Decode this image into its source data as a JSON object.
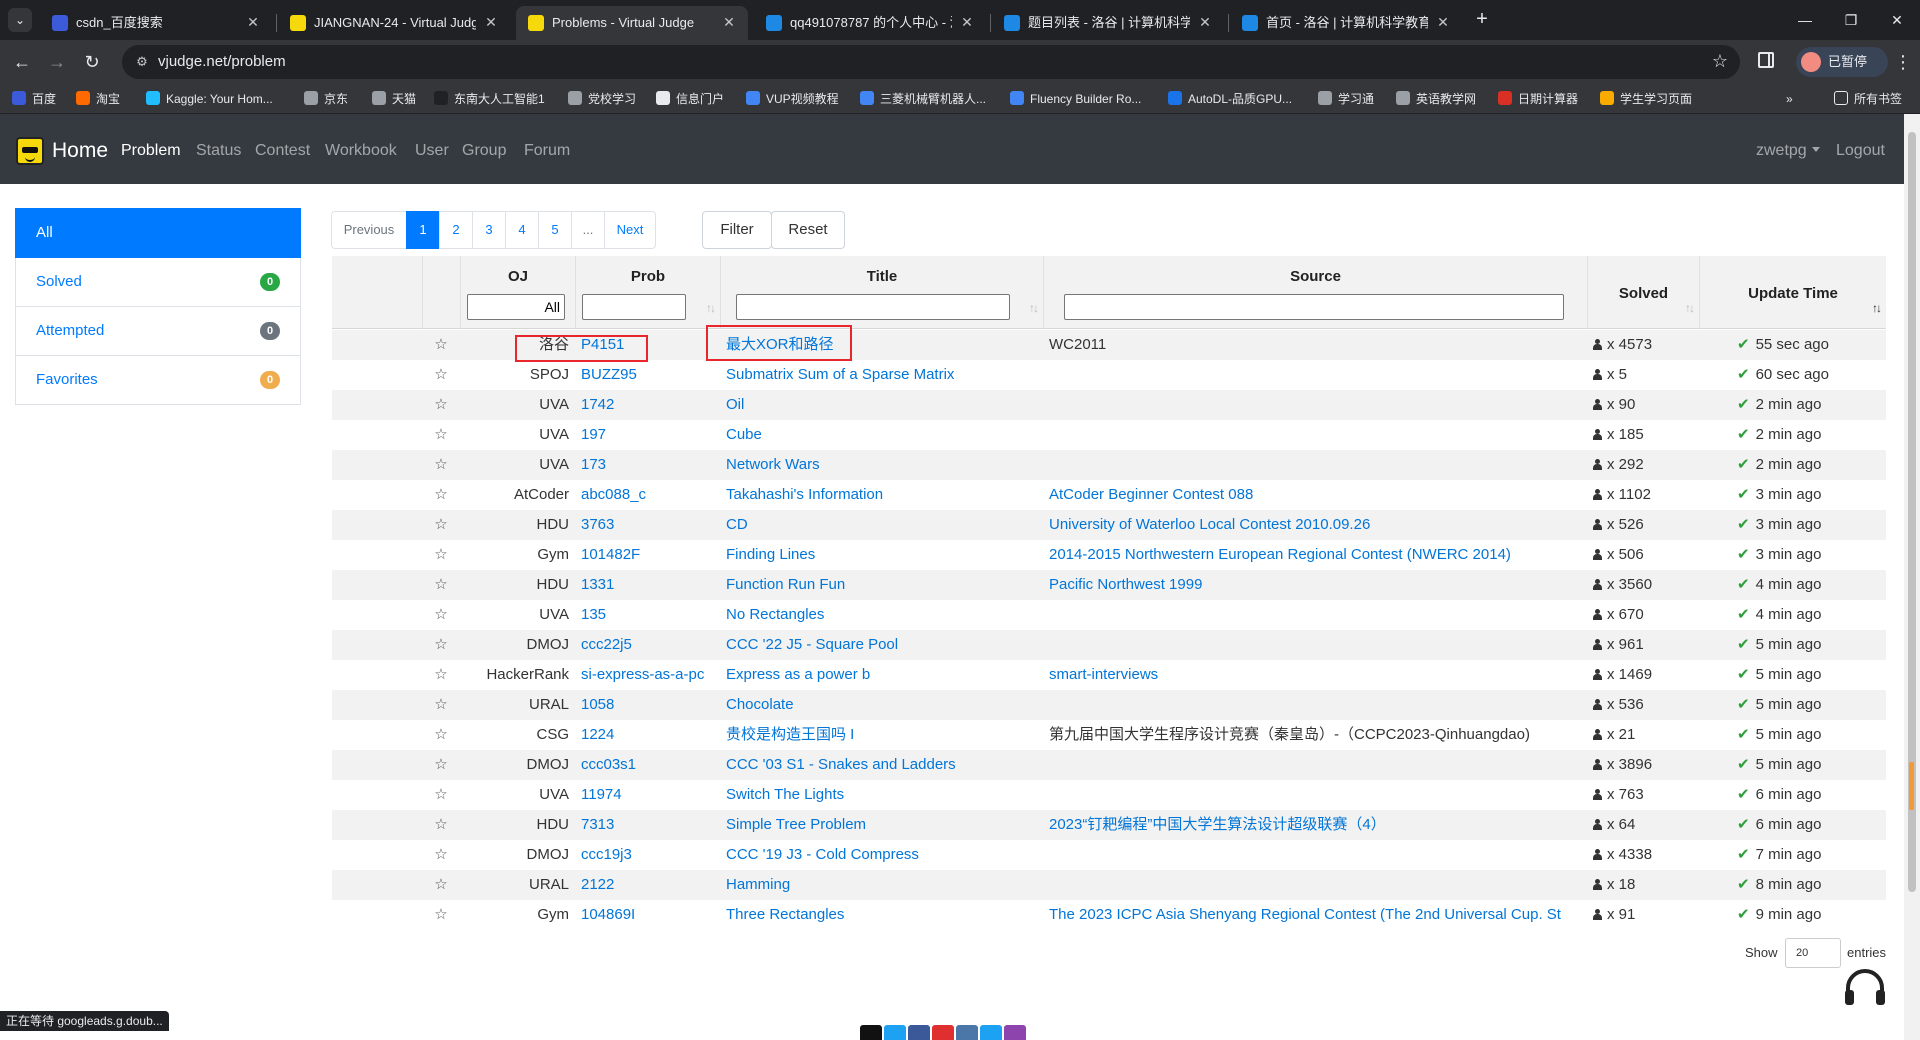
{
  "browser": {
    "tabs": [
      {
        "title": "csdn_百度搜索",
        "active": false,
        "color": "#3b5bdb"
      },
      {
        "title": "JIANGNAN-24 - Virtual Judge",
        "active": false,
        "color": "#f5d90a"
      },
      {
        "title": "Problems - Virtual Judge",
        "active": true,
        "color": "#f5d90a"
      },
      {
        "title": "qq491078787 的个人中心 - 洛谷",
        "active": false,
        "color": "#1e88e5"
      },
      {
        "title": "题目列表 - 洛谷 | 计算机科学教育新生态",
        "active": false,
        "color": "#1e88e5"
      },
      {
        "title": "首页 - 洛谷 | 计算机科学教育新生态",
        "active": false,
        "color": "#1e88e5"
      }
    ],
    "url": "vjudge.net/problem",
    "profile_label": "已暂停",
    "bookmarks": [
      {
        "label": "百度",
        "color": "#3b5bdb"
      },
      {
        "label": "淘宝",
        "color": "#ff6a00"
      },
      {
        "label": "Kaggle: Your Hom...",
        "color": "#20beff"
      },
      {
        "label": "京东",
        "color": "#9aa0a6"
      },
      {
        "label": "天猫",
        "color": "#9aa0a6"
      },
      {
        "label": "东南大人工智能1",
        "color": "#202124"
      },
      {
        "label": "党校学习",
        "color": "#9aa0a6"
      },
      {
        "label": "信息门户",
        "color": "#e8eaed"
      },
      {
        "label": "VUP视频教程",
        "color": "#4285f4"
      },
      {
        "label": "三菱机械臂机器人...",
        "color": "#4285f4"
      },
      {
        "label": "Fluency Builder Ro...",
        "color": "#4285f4"
      },
      {
        "label": "AutoDL-品质GPU...",
        "color": "#1a73e8"
      },
      {
        "label": "学习通",
        "color": "#9aa0a6"
      },
      {
        "label": "英语教学网",
        "color": "#9aa0a6"
      },
      {
        "label": "日期计算器",
        "color": "#d93025"
      },
      {
        "label": "学生学习页面",
        "color": "#f9ab00"
      }
    ],
    "bookmarks_more": "»",
    "all_bookmarks": "所有书签",
    "status_text": "正在等待 googleads.g.doub..."
  },
  "nav": {
    "brand": "Home",
    "links": [
      "Problem",
      "Status",
      "Contest",
      "Workbook",
      "User",
      "Group",
      "Forum"
    ],
    "active_link": "Problem",
    "user": "zwetpg",
    "logout": "Logout"
  },
  "sidebar": {
    "items": [
      {
        "label": "All",
        "badge": "",
        "active": true
      },
      {
        "label": "Solved",
        "badge": "0",
        "badge_color": "#28a745"
      },
      {
        "label": "Attempted",
        "badge": "0",
        "badge_color": "#6c757d"
      },
      {
        "label": "Favorites",
        "badge": "0",
        "badge_color": "#f0ad4e"
      }
    ]
  },
  "pagination": {
    "previous": "Previous",
    "pages": [
      "1",
      "2",
      "3",
      "4",
      "5",
      "..."
    ],
    "current": "1",
    "next": "Next"
  },
  "buttons": {
    "filter": "Filter",
    "reset": "Reset"
  },
  "table": {
    "headers": {
      "oj": "OJ",
      "prob": "Prob",
      "title": "Title",
      "source": "Source",
      "solved": "Solved",
      "update": "Update Time"
    },
    "filters": {
      "oj_value": "All",
      "prob_value": "",
      "title_value": "",
      "source_value": ""
    },
    "rows": [
      {
        "oj": "洛谷",
        "prob": "P4151",
        "title": "最大XOR和路径",
        "source": "WC2011",
        "source_link": false,
        "solved": "x 4573",
        "update": "55 sec ago"
      },
      {
        "oj": "SPOJ",
        "prob": "BUZZ95",
        "title": "Submatrix Sum of a Sparse Matrix",
        "source": "",
        "source_link": false,
        "solved": "x 5",
        "update": "60 sec ago"
      },
      {
        "oj": "UVA",
        "prob": "1742",
        "title": "Oil",
        "source": "",
        "source_link": false,
        "solved": "x 90",
        "update": "2 min ago"
      },
      {
        "oj": "UVA",
        "prob": "197",
        "title": "Cube",
        "source": "",
        "source_link": false,
        "solved": "x 185",
        "update": "2 min ago"
      },
      {
        "oj": "UVA",
        "prob": "173",
        "title": "Network Wars",
        "source": "",
        "source_link": false,
        "solved": "x 292",
        "update": "2 min ago"
      },
      {
        "oj": "AtCoder",
        "prob": "abc088_c",
        "title": "Takahashi's Information",
        "source": "AtCoder Beginner Contest 088",
        "source_link": true,
        "solved": "x 1102",
        "update": "3 min ago"
      },
      {
        "oj": "HDU",
        "prob": "3763",
        "title": "CD",
        "source": "University of Waterloo Local Contest 2010.09.26",
        "source_link": true,
        "solved": "x 526",
        "update": "3 min ago"
      },
      {
        "oj": "Gym",
        "prob": "101482F",
        "title": "Finding Lines",
        "source": "2014-2015 Northwestern European Regional Contest (NWERC 2014)",
        "source_link": true,
        "solved": "x 506",
        "update": "3 min ago"
      },
      {
        "oj": "HDU",
        "prob": "1331",
        "title": "Function Run Fun",
        "source": "Pacific Northwest 1999",
        "source_link": true,
        "solved": "x 3560",
        "update": "4 min ago"
      },
      {
        "oj": "UVA",
        "prob": "135",
        "title": "No Rectangles",
        "source": "",
        "source_link": false,
        "solved": "x 670",
        "update": "4 min ago"
      },
      {
        "oj": "DMOJ",
        "prob": "ccc22j5",
        "title": "CCC '22 J5 - Square Pool",
        "source": "",
        "source_link": false,
        "solved": "x 961",
        "update": "5 min ago"
      },
      {
        "oj": "HackerRank",
        "prob": "si-express-as-a-pc",
        "title": "Express as a power b",
        "source": "smart-interviews",
        "source_link": true,
        "solved": "x 1469",
        "update": "5 min ago"
      },
      {
        "oj": "URAL",
        "prob": "1058",
        "title": "Chocolate",
        "source": "",
        "source_link": false,
        "solved": "x 536",
        "update": "5 min ago"
      },
      {
        "oj": "CSG",
        "prob": "1224",
        "title": "贵校是构造王国吗 I",
        "source": "第九届中国大学生程序设计竞赛（秦皇岛）-（CCPC2023-Qinhuangdao)",
        "source_link": false,
        "solved": "x 21",
        "update": "5 min ago"
      },
      {
        "oj": "DMOJ",
        "prob": "ccc03s1",
        "title": "CCC '03 S1 - Snakes and Ladders",
        "source": "",
        "source_link": false,
        "solved": "x 3896",
        "update": "5 min ago"
      },
      {
        "oj": "UVA",
        "prob": "11974",
        "title": "Switch The Lights",
        "source": "",
        "source_link": false,
        "solved": "x 763",
        "update": "6 min ago"
      },
      {
        "oj": "HDU",
        "prob": "7313",
        "title": "Simple Tree Problem",
        "source": "2023“钉耙编程”中国大学生算法设计超级联赛（4）",
        "source_link": true,
        "solved": "x 64",
        "update": "6 min ago"
      },
      {
        "oj": "DMOJ",
        "prob": "ccc19j3",
        "title": "CCC '19 J3 - Cold Compress",
        "source": "",
        "source_link": false,
        "solved": "x 4338",
        "update": "7 min ago"
      },
      {
        "oj": "URAL",
        "prob": "2122",
        "title": "Hamming",
        "source": "",
        "source_link": false,
        "solved": "x 18",
        "update": "8 min ago"
      },
      {
        "oj": "Gym",
        "prob": "104869I",
        "title": "Three Rectangles",
        "source": "The 2023 ICPC Asia Shenyang Regional Contest (The 2nd Universal Cup. St",
        "source_link": true,
        "solved": "x 91",
        "update": "9 min ago"
      }
    ]
  },
  "entries": {
    "show": "Show",
    "value": "20",
    "suffix": "entries"
  }
}
